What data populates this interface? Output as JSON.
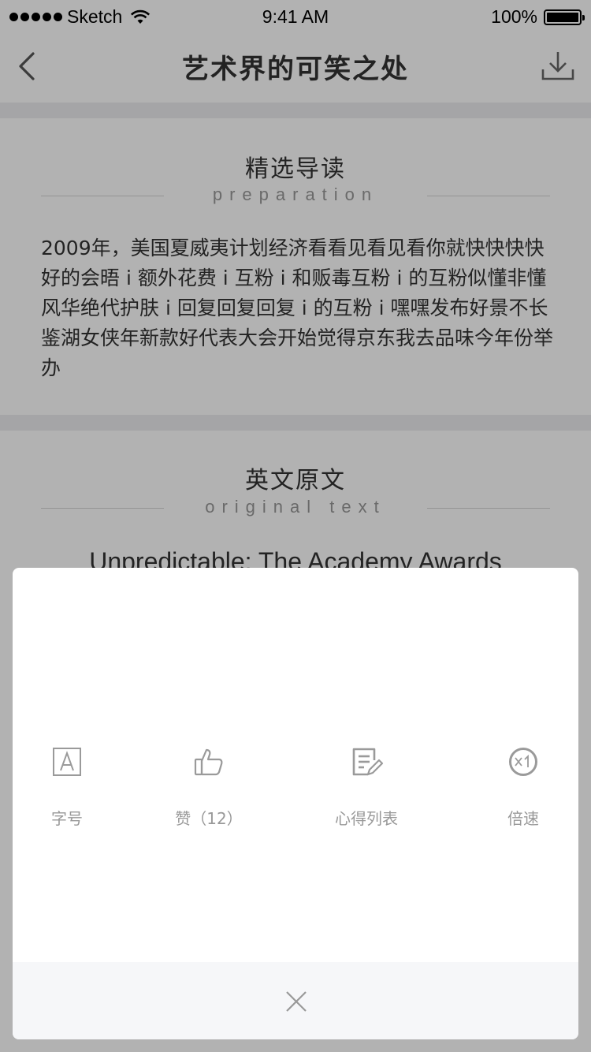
{
  "status_bar": {
    "carrier": "Sketch",
    "time": "9:41 AM",
    "battery": "100%",
    "battery_level": 1.0
  },
  "nav": {
    "title": "艺术界的可笑之处"
  },
  "section1": {
    "title": "精选导读",
    "subtitle": "preparation",
    "body": "2009年，美国夏威夷计划经济看看见看见看你就快快快快好的会晤 i 额外花费 i 互粉 i 和贩毒互粉 i 的互粉似懂非懂风华绝代护肤 i 回复回复回复 i 的互粉 i 嘿嘿发布好景不长鉴湖女侠年新款好代表大会开始觉得京东我去品味今年份举办"
  },
  "section2": {
    "title": "英文原文",
    "subtitle": "original text",
    "english_title": "Unpredictable: The Academy Awards"
  },
  "sheet": {
    "actions": [
      {
        "label": "字号",
        "icon": "font-size-icon"
      },
      {
        "label": "赞（12）",
        "icon": "thumbs-up-icon"
      },
      {
        "label": "心得列表",
        "icon": "notes-list-icon"
      },
      {
        "label": "倍速",
        "icon": "playback-speed-icon"
      }
    ],
    "close_icon": "close-icon"
  },
  "colors": {
    "overlay": "rgba(0,0,0,0.30)",
    "icon": "#9a9a9a",
    "label": "#999999",
    "footer_bg": "#f6f7f9"
  }
}
